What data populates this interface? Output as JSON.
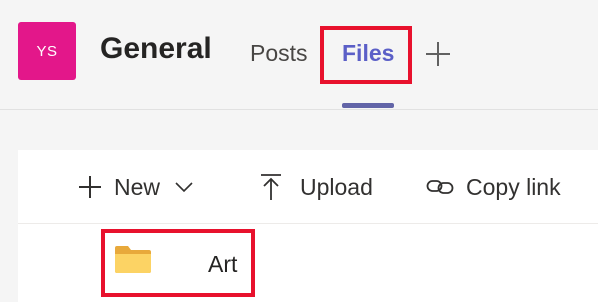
{
  "team": {
    "avatar_initials": "YS",
    "avatar_color": "#e3178a"
  },
  "channel": {
    "title": "General"
  },
  "tabs": [
    {
      "label": "Posts",
      "active": false
    },
    {
      "label": "Files",
      "active": true
    }
  ],
  "add_tab_icon": "plus-icon",
  "toolbar": {
    "new_label": "New",
    "upload_label": "Upload",
    "copy_link_label": "Copy link"
  },
  "files": [
    {
      "name": "Art",
      "type": "folder"
    }
  ],
  "colors": {
    "accent": "#6264a7",
    "highlight": "#e8112d",
    "folder": "#f2c94c"
  }
}
